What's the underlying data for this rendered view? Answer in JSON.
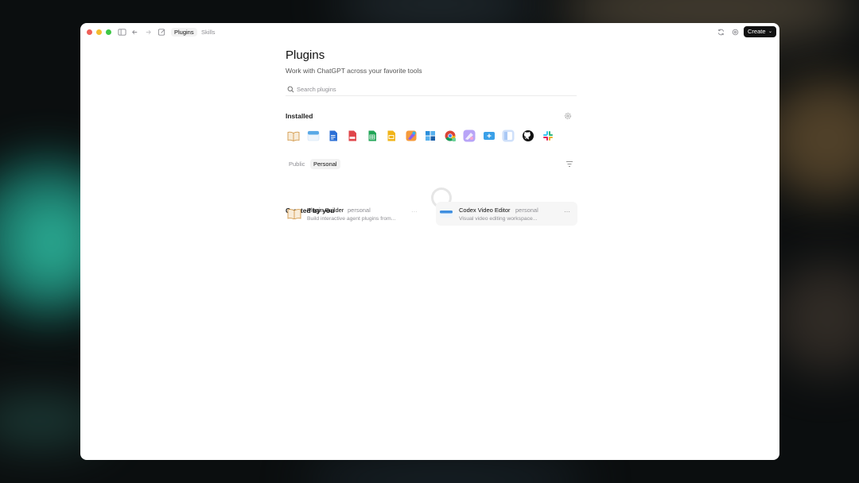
{
  "toolbar": {
    "tabs": [
      {
        "label": "Plugins",
        "active": true
      },
      {
        "label": "Skills",
        "active": false
      }
    ],
    "create_label": "Create"
  },
  "page": {
    "title": "Plugins",
    "subtitle": "Work with ChatGPT across your favorite tools"
  },
  "search": {
    "placeholder": "Search plugins",
    "value": ""
  },
  "installed": {
    "title": "Installed",
    "icons": [
      {
        "name": "book-icon",
        "color": "#e9a04b"
      },
      {
        "name": "calendar-icon",
        "color": "#5aa9e6"
      },
      {
        "name": "docs-icon",
        "color": "#2b6fd6"
      },
      {
        "name": "pdf-icon",
        "color": "#e0454a"
      },
      {
        "name": "sheets-icon",
        "color": "#21a557"
      },
      {
        "name": "slides-icon",
        "color": "#f1b418"
      },
      {
        "name": "figma-icon",
        "color": "#f27a40"
      },
      {
        "name": "windows-icon",
        "color": "#2b8fdc"
      },
      {
        "name": "chrome-icon",
        "color": "#4285f4"
      },
      {
        "name": "design-app-icon",
        "color": "#9c7cf2"
      },
      {
        "name": "add-screen-icon",
        "color": "#3aa0e8"
      },
      {
        "name": "preview-icon",
        "color": "#a9c8f5"
      },
      {
        "name": "github-icon",
        "color": "#111111"
      },
      {
        "name": "slack-icon",
        "color": "#e01e5a"
      }
    ]
  },
  "filters": {
    "tabs": [
      {
        "label": "Public",
        "active": false
      },
      {
        "label": "Personal",
        "active": true
      }
    ]
  },
  "created": {
    "title": "Created by you",
    "items": [
      {
        "name": "Plugin Builder",
        "tag": "personal",
        "description": "Build interactive agent plugins from..."
      },
      {
        "name": "Codex Video Editor",
        "tag": "personal",
        "description": "Visual video editing workspace..."
      }
    ]
  }
}
